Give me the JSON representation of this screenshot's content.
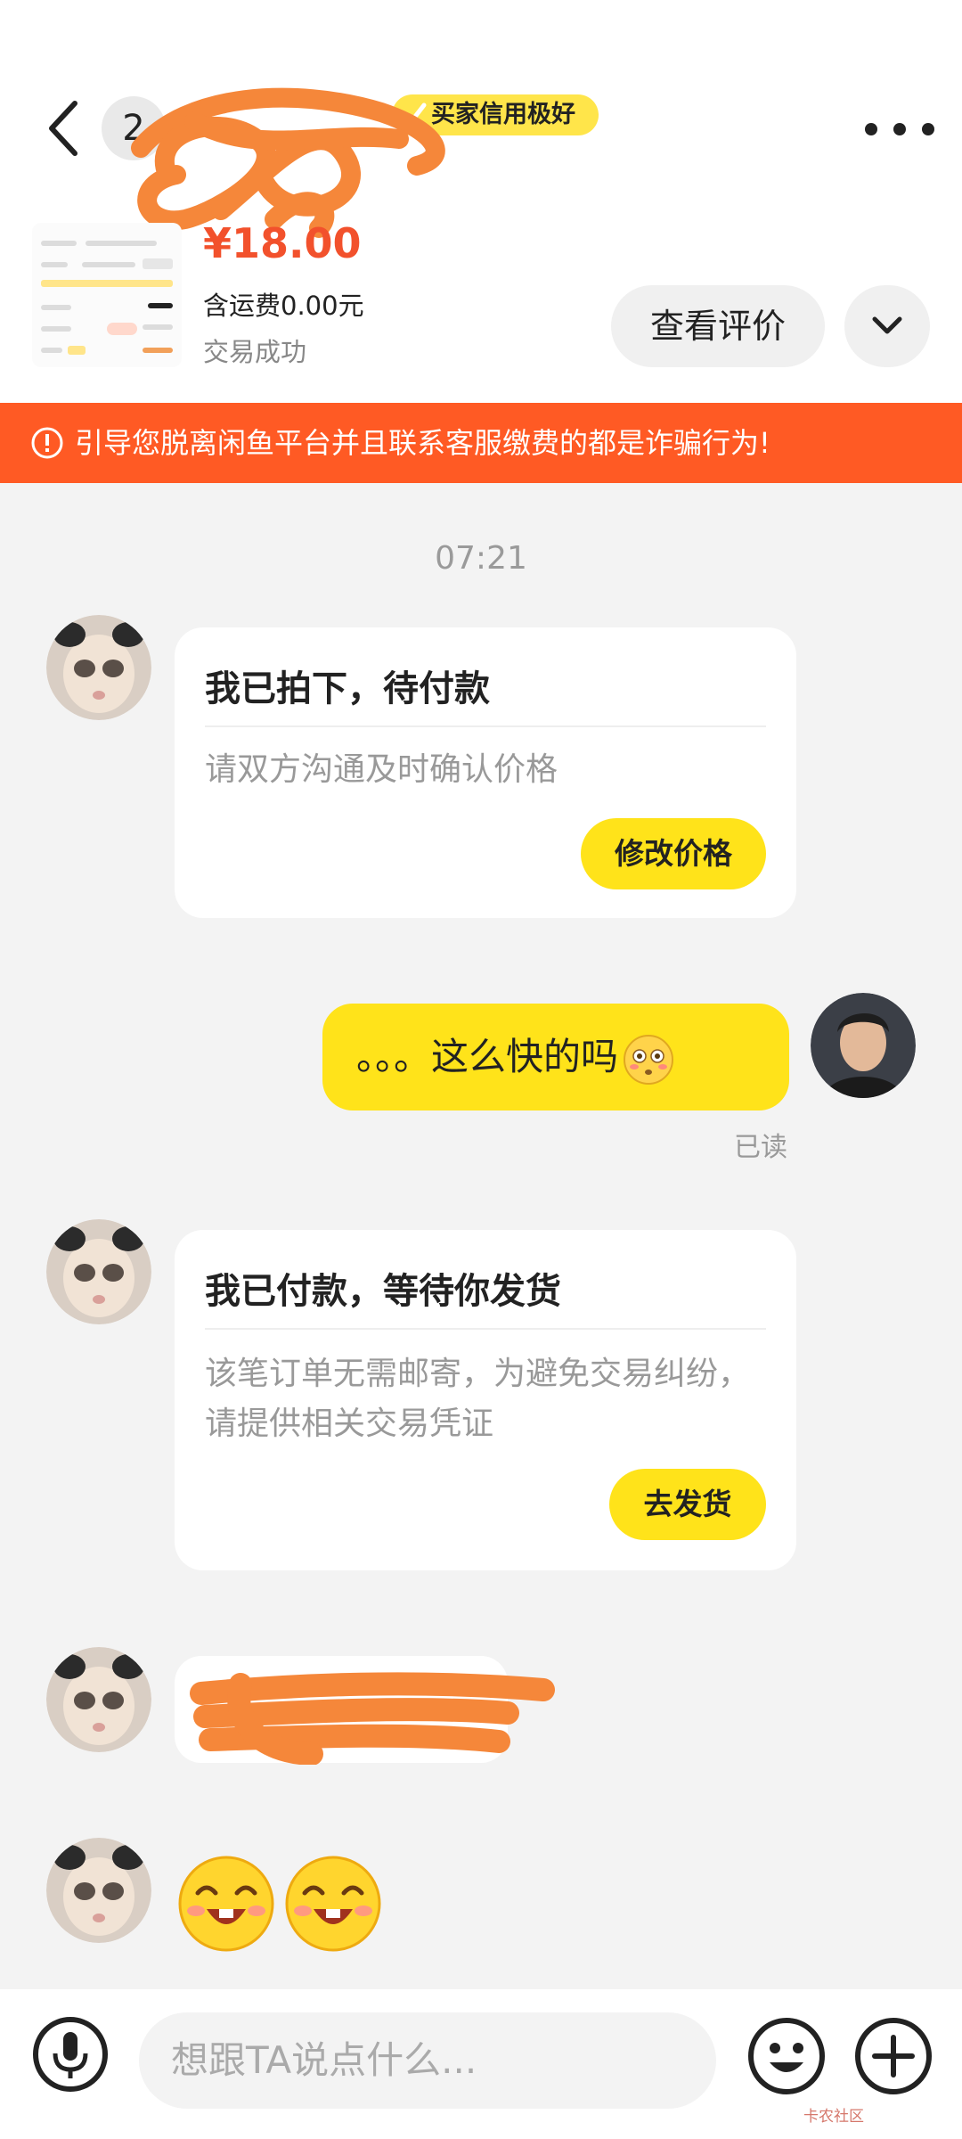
{
  "header": {
    "unread_count": "2",
    "credit_tag": "买家信用极好"
  },
  "product": {
    "price": "¥18.00",
    "shipping": "含运费0.00元",
    "status": "交易成功",
    "review_button": "查看评价"
  },
  "warning": {
    "text": "引导您脱离闲鱼平台并且联系客服缴费的都是诈骗行为!"
  },
  "chat": {
    "timestamp": "07:21",
    "messages": [
      {
        "title": "我已拍下，待付款",
        "desc": "请双方沟通及时确认价格",
        "button": "修改价格"
      },
      {
        "text": "。。。这么快的吗",
        "read_status": "已读"
      },
      {
        "title": "我已付款，等待你发货",
        "desc": "该笔订单无需邮寄，为避免交易纠纷，请提供相关交易凭证",
        "button": "去发货"
      }
    ]
  },
  "input": {
    "placeholder": "想跟TA说点什么..."
  },
  "watermark": "卡农社区",
  "colors": {
    "accent_yellow": "#ffe31a",
    "warning_orange": "#ff5a24",
    "price_red": "#f2512c",
    "background": "#f3f3f3"
  }
}
